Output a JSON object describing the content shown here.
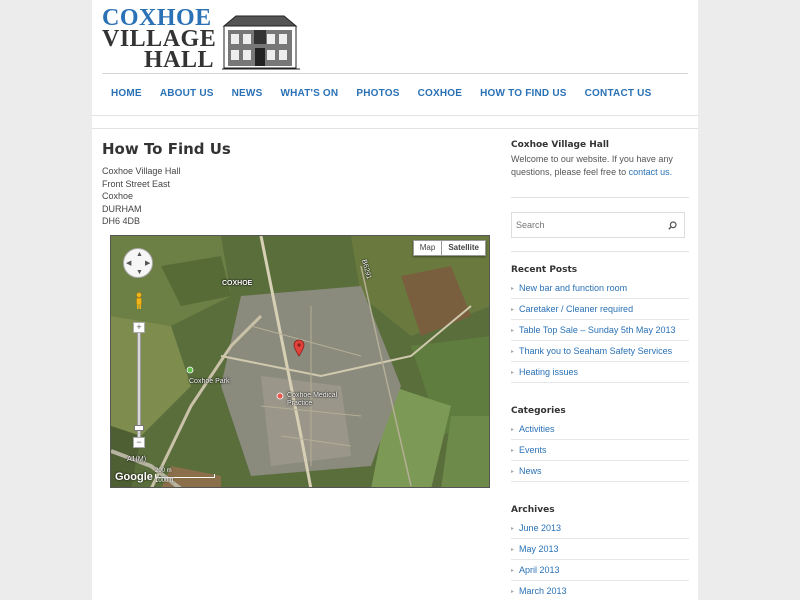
{
  "logo": {
    "line1": "COXHOE",
    "line2": "VILLAGE",
    "line3": "HALL"
  },
  "nav": {
    "items": [
      {
        "label": "HOME"
      },
      {
        "label": "ABOUT US"
      },
      {
        "label": "NEWS"
      },
      {
        "label": "WHAT'S ON"
      },
      {
        "label": "PHOTOS"
      },
      {
        "label": "COXHOE"
      },
      {
        "label": "HOW TO FIND US"
      },
      {
        "label": "CONTACT US"
      }
    ]
  },
  "main": {
    "title": "How To Find Us",
    "address": [
      "Coxhoe Village Hall",
      "Front Street East",
      "Coxhoe",
      "DURHAM",
      "DH6 4DB"
    ]
  },
  "map": {
    "type_map": "Map",
    "type_satellite": "Satellite",
    "selected_type": "Satellite",
    "label_town": "COXHOE",
    "label_park": "Coxhoe Park",
    "label_practice": "Coxhoe Medical Practice",
    "label_road": "A1(M)",
    "label_b": "B6291",
    "label_logo": "Google",
    "scale_metric": "200 m",
    "scale_imperial": "1000 ft",
    "zoom_in": "+",
    "zoom_out": "−"
  },
  "sidebar": {
    "about_title": "Coxhoe Village Hall",
    "about_text": "Welcome to our website. If you have any questions, please feel free to",
    "about_link": "contact us.",
    "search_placeholder": "Search",
    "recent_title": "Recent Posts",
    "recent_posts": [
      "New bar and function room",
      "Caretaker / Cleaner required",
      "Table Top Sale – Sunday 5th May 2013",
      "Thank you to Seaham Safety Services",
      "Heating issues"
    ],
    "categories_title": "Categories",
    "categories": [
      "Activities",
      "Events",
      "News"
    ],
    "archives_title": "Archives",
    "archives": [
      "June 2013",
      "May 2013",
      "April 2013",
      "March 2013"
    ]
  },
  "colors": {
    "accent": "#2a71b5",
    "page_bg": "#ececec"
  }
}
